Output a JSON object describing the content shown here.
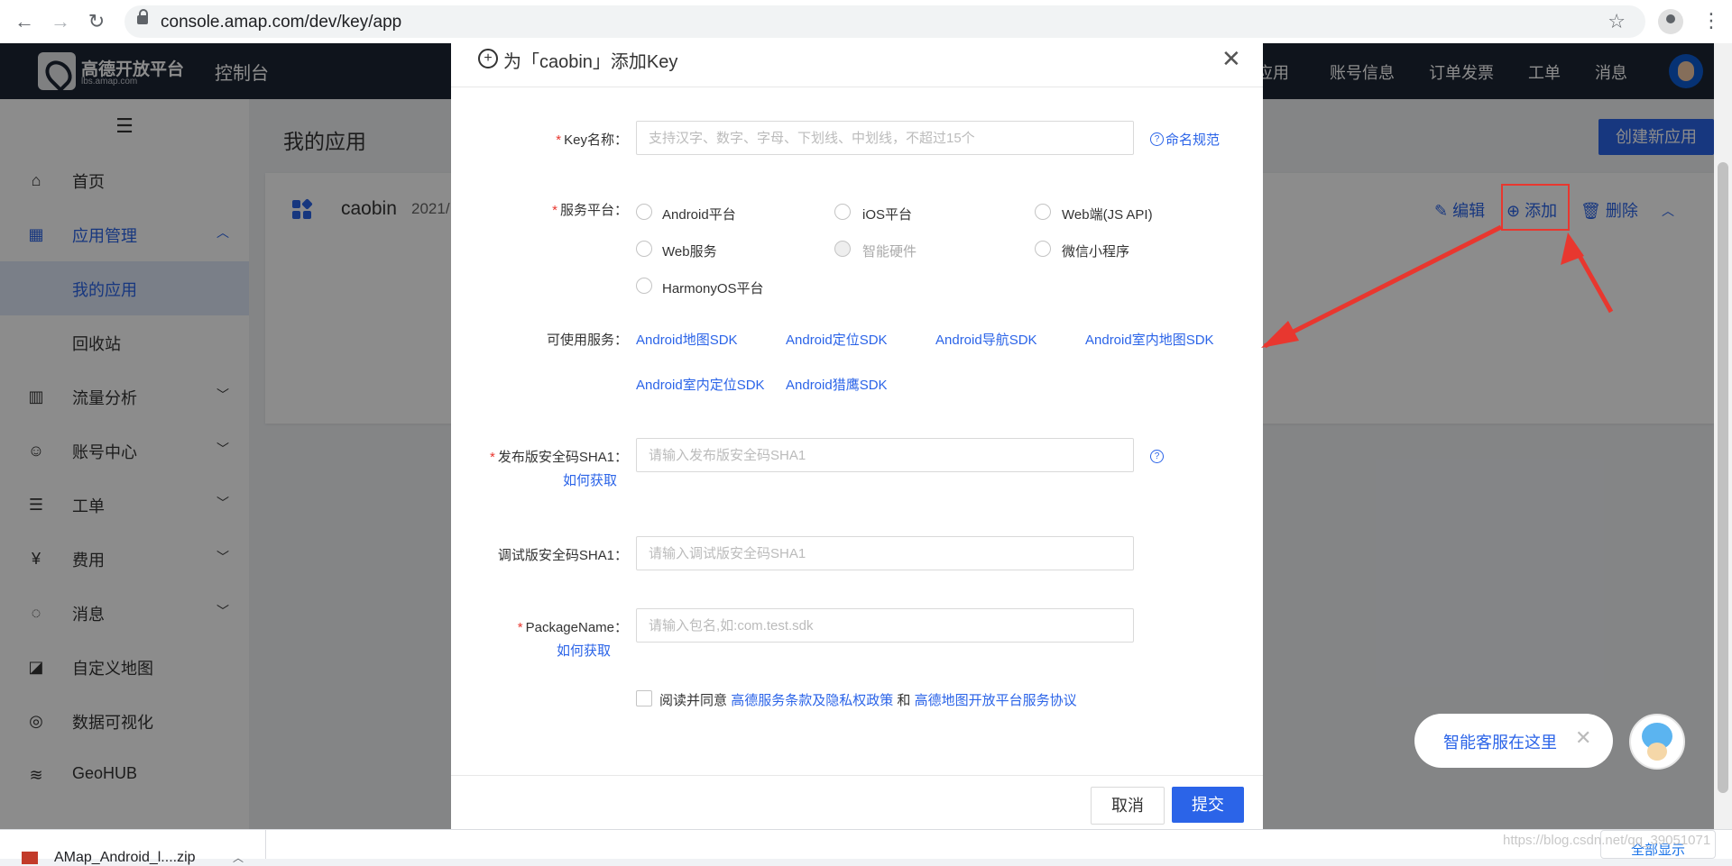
{
  "browser": {
    "url": "console.amap.com/dev/key/app"
  },
  "topnav": {
    "logo_text": "高德开放平台",
    "logo_sub": "lbs.amap.com",
    "console": "控制台",
    "links": [
      "应用",
      "账号信息",
      "订单发票",
      "工单",
      "消息"
    ]
  },
  "sidebar": {
    "menu_icon": "☰",
    "items": [
      {
        "icon": "home-icon",
        "label": "首页"
      },
      {
        "icon": "grid-icon",
        "label": "应用管理"
      },
      {
        "icon": "",
        "label": "我的应用"
      },
      {
        "icon": "",
        "label": "回收站"
      },
      {
        "icon": "chart-icon",
        "label": "流量分析"
      },
      {
        "icon": "user-icon",
        "label": "账号中心"
      },
      {
        "icon": "ticket-icon",
        "label": "工单"
      },
      {
        "icon": "yen-icon",
        "label": "费用"
      },
      {
        "icon": "message-icon",
        "label": "消息"
      },
      {
        "icon": "map-icon",
        "label": "自定义地图"
      },
      {
        "icon": "visual-icon",
        "label": "数据可视化"
      },
      {
        "icon": "layers-icon",
        "label": "GeoHUB"
      }
    ]
  },
  "main": {
    "title": "我的应用",
    "create_button": "创建新应用",
    "app": {
      "name": "caobin",
      "date": "2021/",
      "edit": "编辑",
      "add": "添加",
      "delete": "删除"
    }
  },
  "modal": {
    "title": "为「caobin」添加Key",
    "key_name_label": "Key名称：",
    "key_name_placeholder": "支持汉字、数字、字母、下划线、中划线，不超过15个",
    "naming_rule": "命名规范",
    "platform_label": "服务平台：",
    "platforms": [
      "Android平台",
      "iOS平台",
      "Web端(JS API)",
      "Web服务",
      "智能硬件",
      "微信小程序",
      "HarmonyOS平台"
    ],
    "services_label": "可使用服务：",
    "services": [
      "Android地图SDK",
      "Android定位SDK",
      "Android导航SDK",
      "Android室内地图SDK",
      "Android室内定位SDK",
      "Android猎鹰SDK"
    ],
    "sha1_release_label": "发布版安全码SHA1：",
    "sha1_release_placeholder": "请输入发布版安全码SHA1",
    "how_to_get": "如何获取",
    "sha1_debug_label": "调试版安全码SHA1：",
    "sha1_debug_placeholder": "请输入调试版安全码SHA1",
    "package_label": "PackageName：",
    "package_placeholder": "请输入包名,如:com.test.sdk",
    "agree_prefix": "阅读并同意",
    "agree_link1": "高德服务条款及隐私权政策",
    "agree_and": "和",
    "agree_link2": "高德地图开放平台服务协议",
    "cancel": "取消",
    "submit": "提交"
  },
  "chat": {
    "text": "智能客服在这里"
  },
  "downloads": {
    "file": "AMap_Android_l....zip",
    "show_all": "全部显示"
  },
  "watermark": "https://blog.csdn.net/qq_39051071",
  "colors": {
    "accent": "#2b64e8",
    "header": "#1c2534",
    "annotation_red": "#e8372f"
  }
}
